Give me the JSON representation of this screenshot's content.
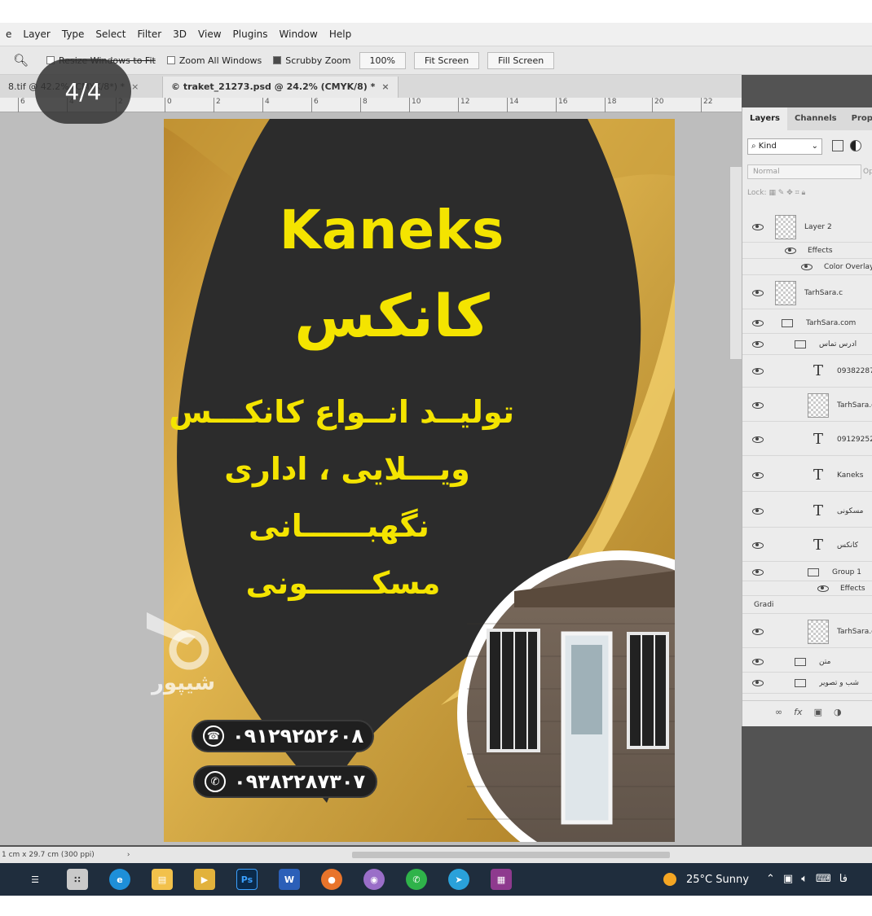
{
  "menu": [
    "e",
    "Layer",
    "Type",
    "Select",
    "Filter",
    "3D",
    "View",
    "Plugins",
    "Window",
    "Help"
  ],
  "options": {
    "resize_label": "Resize Windows to Fit",
    "zoom_all_label": "Zoom All Windows",
    "scrubby_label": "Scrubby Zoom",
    "zoom_value": "100%",
    "fit_screen": "Fit Screen",
    "fill_screen": "Fill Screen"
  },
  "tabs": [
    {
      "label": "8.tif @ 42.2% (CMYK/8*) *",
      "close": "×"
    },
    {
      "label": "© traket_21273.psd @ 24.2% (CMYK/8) *",
      "close": "×"
    }
  ],
  "ruler": [
    "6",
    "4",
    "2",
    "0",
    "2",
    "4",
    "6",
    "8",
    "10",
    "12",
    "14",
    "16",
    "18",
    "20",
    "22"
  ],
  "badge": "4/4",
  "flyer": {
    "brand_en": "Kaneks",
    "brand_fa": "کانکس",
    "line1": "تولیــد انــواع کانکـــس",
    "line2": "ویـــلایی ، اداری",
    "line3": "نگهبــــــانی",
    "line4": "مسکــــــونی",
    "phone1": "۰۹۱۲۹۲۵۲۶۰۸",
    "phone2": "۰۹۳۸۲۲۸۷۳۰۷",
    "colors": {
      "gold": "#d9a93a",
      "dark": "#2b2b2b",
      "yellow": "#f4e400"
    }
  },
  "watermark": "شیپور",
  "layers_panel": {
    "tabs": [
      "Layers",
      "Channels",
      "Propert"
    ],
    "kind": "Kind",
    "blend": "Normal",
    "opacity_label": "Op",
    "lock_label": "Lock:",
    "rows": [
      {
        "name": "Layer 2",
        "type": "pixel"
      },
      {
        "name": "Effects",
        "type": "effect"
      },
      {
        "name": "Color Overlay",
        "type": "effect"
      },
      {
        "name": "TarhSara.c",
        "type": "pixel"
      },
      {
        "name": "TarhSara.com",
        "type": "group"
      },
      {
        "name": "ادرس تماس",
        "type": "group"
      },
      {
        "name": "093822873",
        "type": "text"
      },
      {
        "name": "TarhSara.c",
        "type": "pixel"
      },
      {
        "name": "091292526",
        "type": "text"
      },
      {
        "name": "Kaneks",
        "type": "text"
      },
      {
        "name": "مسکونی",
        "type": "text"
      },
      {
        "name": "کانکس",
        "type": "text"
      },
      {
        "name": "Group 1",
        "type": "group"
      },
      {
        "name": "Effects",
        "type": "effect"
      },
      {
        "name": "Gradi",
        "type": "effect"
      },
      {
        "name": "TarhSara.c",
        "type": "pixel"
      },
      {
        "name": "متن",
        "type": "group"
      },
      {
        "name": "شب و تصویر",
        "type": "group"
      }
    ]
  },
  "status": "1 cm x 29.7 cm (300 ppi)",
  "status_arrow": "›",
  "taskbar": {
    "weather_temp": "25°C",
    "weather_text": "Sunny",
    "lang": "فا"
  }
}
